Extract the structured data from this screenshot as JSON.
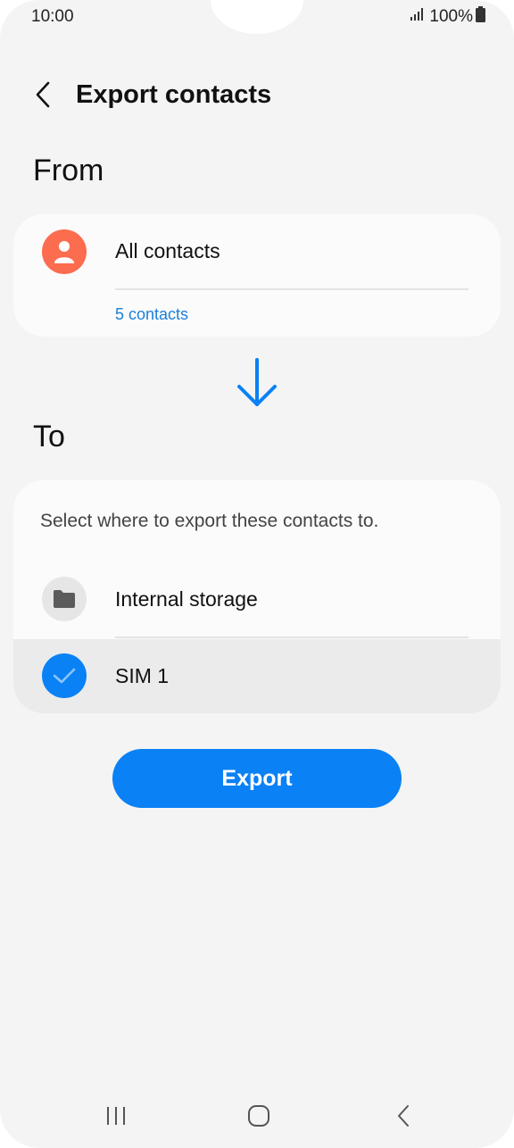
{
  "status_bar": {
    "time": "10:00",
    "battery": "100%",
    "icons": [
      "signal-icon",
      "battery-icon"
    ]
  },
  "header": {
    "title": "Export contacts",
    "back_icon": "chevron-left-icon"
  },
  "from": {
    "heading": "From",
    "source_label": "All contacts",
    "source_icon": "person-icon",
    "count_text": "5 contacts"
  },
  "arrow_icon": "arrow-down-icon",
  "to": {
    "heading": "To",
    "hint": "Select where to export these contacts to.",
    "options": [
      {
        "label": "Internal storage",
        "icon": "folder-icon",
        "selected": false
      },
      {
        "label": "SIM 1",
        "icon": "check-icon",
        "selected": true
      }
    ]
  },
  "export_button": {
    "label": "Export"
  },
  "nav": {
    "icons": [
      "recent-apps-icon",
      "home-icon",
      "back-icon"
    ]
  },
  "colors": {
    "accent": "#0A81F5",
    "avatar_orange": "#FB6D4E",
    "link_blue": "#1A7FD9",
    "background": "#F4F4F4",
    "card": "#FBFBFB"
  }
}
